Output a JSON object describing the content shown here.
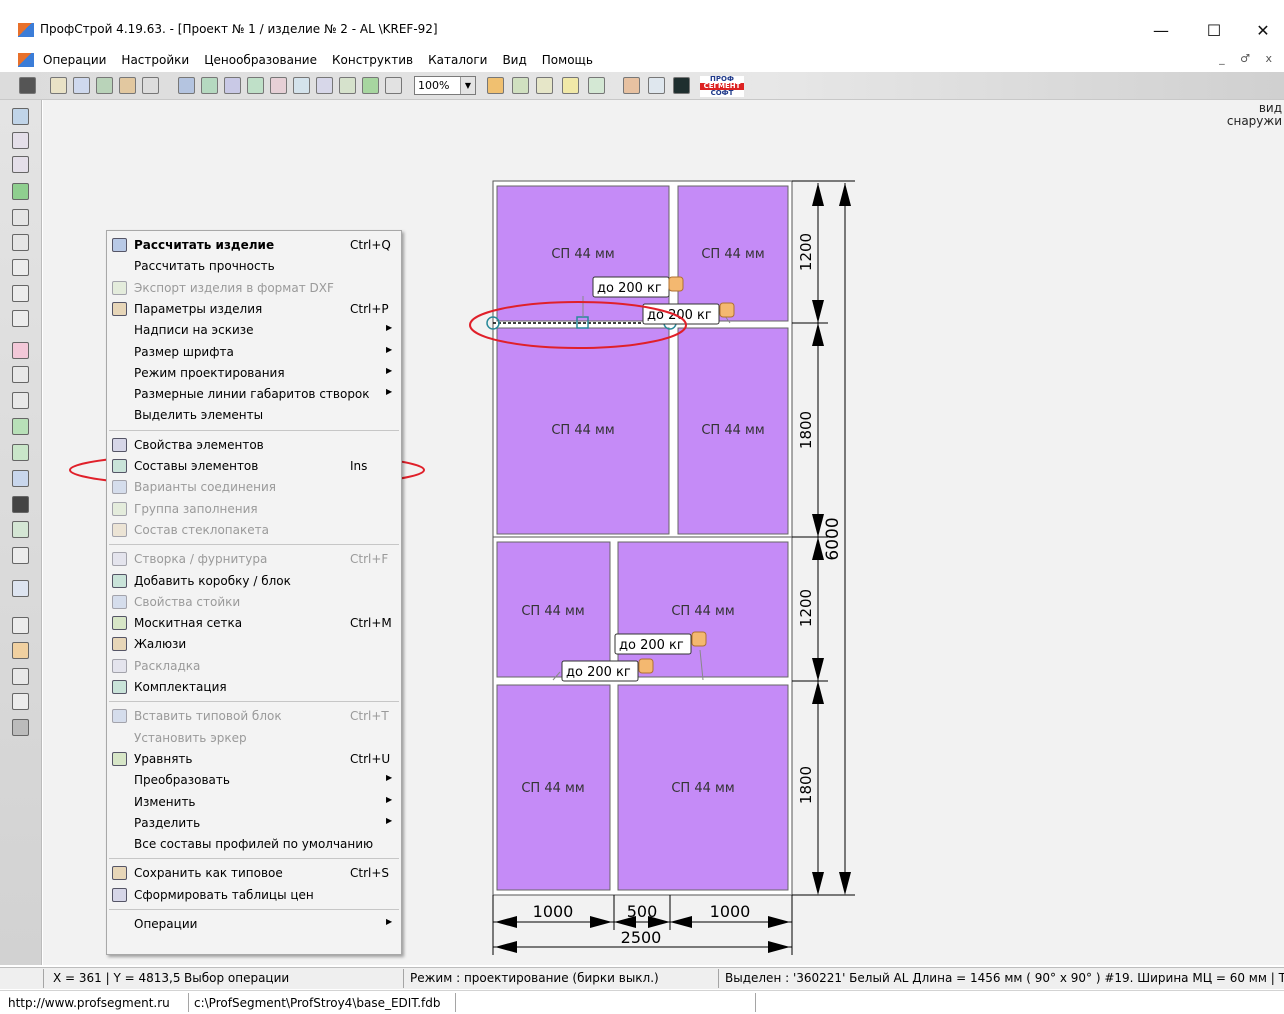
{
  "window": {
    "title": "ПрофСтрой 4.19.63. - [Проект № 1 / изделие № 2  -  AL \\KREF-92]",
    "controls": [
      "—",
      "☐",
      "✕"
    ]
  },
  "menubar": {
    "items": [
      "Операции",
      "Настройки",
      "Ценообразование",
      "Конструктив",
      "Каталоги",
      "Вид",
      "Помощь"
    ],
    "mdi_controls": "_ ♂ x"
  },
  "toolbar": {
    "zoom": "100%",
    "logo": [
      "ПРОФ",
      "СЕГМЕНТ",
      "СОФТ"
    ]
  },
  "view_label": {
    "line1": "вид",
    "line2": "снаружи"
  },
  "context_menu": {
    "items": [
      {
        "label": "Рассчитать изделие",
        "shortcut": "Ctrl+Q",
        "icon": "calculator-icon",
        "state": "bold"
      },
      {
        "label": "Рассчитать прочность"
      },
      {
        "label": "Экспорт изделия в формат DXF",
        "icon": "dxf-export-icon",
        "state": "disabled"
      },
      {
        "label": "Параметры изделия",
        "shortcut": "Ctrl+P",
        "icon": "parameters-icon"
      },
      {
        "label": "Надписи на эскизе",
        "submenu": true
      },
      {
        "label": "Размер шрифта",
        "submenu": true
      },
      {
        "label": "Режим проектирования",
        "submenu": true
      },
      {
        "label": "Размерные линии габаритов створок",
        "submenu": true
      },
      {
        "label": "Выделить элементы"
      },
      {
        "separator": true
      },
      {
        "label": "Свойства элементов",
        "icon": "properties-icon"
      },
      {
        "label": "Составы элементов",
        "shortcut": "Ins",
        "icon": "compositions-icon"
      },
      {
        "label": "Варианты соединения",
        "icon": "connection-icon",
        "state": "disabled"
      },
      {
        "label": "Группа заполнения",
        "icon": "fill-group-icon",
        "state": "disabled"
      },
      {
        "label": "Состав стеклопакета",
        "icon": "glass-unit-icon",
        "state": "disabled"
      },
      {
        "separator": true
      },
      {
        "label": "Створка  /  фурнитура",
        "shortcut": "Ctrl+F",
        "icon": "sash-icon",
        "state": "disabled"
      },
      {
        "label": "Добавить коробку / блок",
        "icon": "add-frame-icon"
      },
      {
        "label": "Свойства стойки",
        "icon": "mullion-icon",
        "state": "disabled"
      },
      {
        "label": "Москитная  сетка",
        "shortcut": "Ctrl+M",
        "icon": "mosquito-net-icon"
      },
      {
        "label": "Жалюзи",
        "icon": "blinds-icon"
      },
      {
        "label": "Раскладка",
        "icon": "grid-layout-icon",
        "state": "disabled"
      },
      {
        "label": "Комплектация",
        "icon": "kit-icon"
      },
      {
        "separator": true
      },
      {
        "label": "Вставить типовой блок",
        "shortcut": "Ctrl+T",
        "icon": "insert-block-icon",
        "state": "disabled"
      },
      {
        "label": "Установить эркер",
        "state": "disabled"
      },
      {
        "label": "Уравнять",
        "shortcut": "Ctrl+U",
        "icon": "equalize-icon"
      },
      {
        "label": "Преобразовать",
        "submenu": true
      },
      {
        "label": "Изменить",
        "submenu": true
      },
      {
        "label": "Разделить",
        "submenu": true
      },
      {
        "label": "Все составы профилей по умолчанию"
      },
      {
        "separator": true
      },
      {
        "label": "Сохранить как типовое",
        "shortcut": "Ctrl+S",
        "icon": "save-template-icon"
      },
      {
        "label": "Сформировать таблицы цен",
        "icon": "price-table-icon"
      },
      {
        "separator": true
      },
      {
        "label": "Операции",
        "submenu": true
      }
    ]
  },
  "drawing": {
    "panel_label": "СП 44 мм",
    "load_tag": "до 200 кг",
    "dims": {
      "top_right": "1200",
      "mid_right": "1800",
      "lower_right": "1200",
      "bottom_right": "1800",
      "total_height": "6000",
      "bottom_left": "1000",
      "bottom_mid": "500",
      "bottom_right_w": "1000",
      "total_width": "2500"
    },
    "colors": {
      "panel": "#c58bf7",
      "frame": "#ffffff",
      "highlight": "#e0202a"
    }
  },
  "statusbar": {
    "coords": "X = 361 | Y = 4813,5",
    "operation": "Выбор операции",
    "mode": "Режим : проектирование  (бирки выкл.)",
    "selection": "Выделен : '360221' Белый AL   Длина = 1456 мм ( 90° x 90° )  #19.   Ширина МЦ = 60 мм | Т",
    "url": "http://www.profsegment.ru",
    "path": "c:\\ProfSegment\\ProfStroy4\\base_EDIT.fdb"
  }
}
